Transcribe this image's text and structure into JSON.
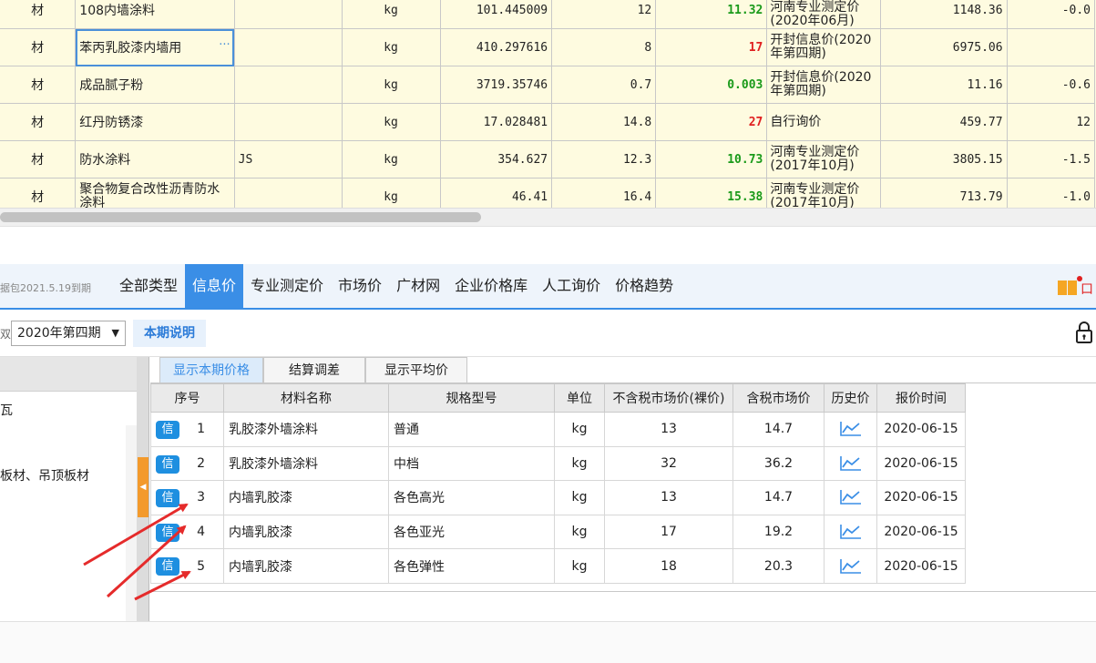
{
  "upper_grid": {
    "rows": [
      {
        "type": "材",
        "name": "108内墙涂料",
        "spec": "",
        "unit": "kg",
        "qty": "101.445009",
        "rate": "12",
        "ratio": "11.32",
        "ratio_color": "green",
        "source": "(2020年06月)",
        "source_top": "河南专业测定价",
        "amount": "1148.36",
        "diff": "-0.0"
      },
      {
        "type": "材",
        "name": "苯丙乳胶漆内墙用",
        "name_suffix": "···",
        "spec": "",
        "unit": "kg",
        "qty": "410.297616",
        "rate": "8",
        "ratio": "17",
        "ratio_color": "red",
        "source": "开封信息价(2020年第四期)",
        "amount": "6975.06",
        "diff": ""
      },
      {
        "type": "材",
        "name": "成品腻子粉",
        "spec": "",
        "unit": "kg",
        "qty": "3719.35746",
        "rate": "0.7",
        "ratio": "0.003",
        "ratio_color": "green",
        "source": "开封信息价(2020年第四期)",
        "amount": "11.16",
        "diff": "-0.6"
      },
      {
        "type": "材",
        "name": "红丹防锈漆",
        "spec": "",
        "unit": "kg",
        "qty": "17.028481",
        "rate": "14.8",
        "ratio": "27",
        "ratio_color": "red",
        "source": "自行询价",
        "amount": "459.77",
        "diff": "12"
      },
      {
        "type": "材",
        "name": "防水涂料",
        "spec": "JS",
        "unit": "kg",
        "qty": "354.627",
        "rate": "12.3",
        "ratio": "10.73",
        "ratio_color": "green",
        "source": "河南专业测定价(2017年10月)",
        "amount": "3805.15",
        "diff": "-1.5"
      },
      {
        "type": "材",
        "name": "聚合物复合改性沥青防水涂料",
        "spec": "",
        "unit": "kg",
        "qty": "46.41",
        "rate": "16.4",
        "ratio": "15.38",
        "ratio_color": "green",
        "source": "河南专业测定价(2017年10月)",
        "amount": "713.79",
        "diff": "-1.0"
      }
    ]
  },
  "tabbar": {
    "notice": "据包2021.5.19到期",
    "tabs": [
      "全部类型",
      "信息价",
      "专业测定价",
      "市场价",
      "广材网",
      "企业价格库",
      "人工询价",
      "价格趋势"
    ],
    "active_tab": "信息价",
    "logo_text": "口"
  },
  "toolbar": {
    "period_label": "双",
    "period_value": "2020年第四期",
    "explain_button": "本期说明"
  },
  "left_panel": {
    "categories": [
      "瓦",
      "板材、吊顶板材"
    ]
  },
  "sub_tabs": [
    "显示本期价格",
    "结算调差",
    "显示平均价"
  ],
  "price_table": {
    "headers": [
      "序号",
      "材料名称",
      "规格型号",
      "单位",
      "不含税市场价(裸价)",
      "含税市场价",
      "历史价",
      "报价时间"
    ],
    "badge": "信",
    "rows": [
      {
        "seq": "1",
        "name": "乳胶漆外墙涂料",
        "spec": "普通",
        "unit": "kg",
        "price_ex": "13",
        "price_in": "14.7",
        "date": "2020-06-15"
      },
      {
        "seq": "2",
        "name": "乳胶漆外墙涂料",
        "spec": "中档",
        "unit": "kg",
        "price_ex": "32",
        "price_in": "36.2",
        "date": "2020-06-15"
      },
      {
        "seq": "3",
        "name": "内墙乳胶漆",
        "spec": "各色高光",
        "unit": "kg",
        "price_ex": "13",
        "price_in": "14.7",
        "date": "2020-06-15"
      },
      {
        "seq": "4",
        "name": "内墙乳胶漆",
        "spec": "各色亚光",
        "unit": "kg",
        "price_ex": "17",
        "price_in": "19.2",
        "date": "2020-06-15"
      },
      {
        "seq": "5",
        "name": "内墙乳胶漆",
        "spec": "各色弹性",
        "unit": "kg",
        "price_ex": "18",
        "price_in": "20.3",
        "date": "2020-06-15"
      }
    ]
  },
  "colors": {
    "accent": "#3a8ee6",
    "badge": "#1e8fe0",
    "ratio_green": "#1a9a1a",
    "ratio_red": "#e02020",
    "arrow_red": "#e52b2b",
    "grid_bg": "#fefbe0"
  }
}
